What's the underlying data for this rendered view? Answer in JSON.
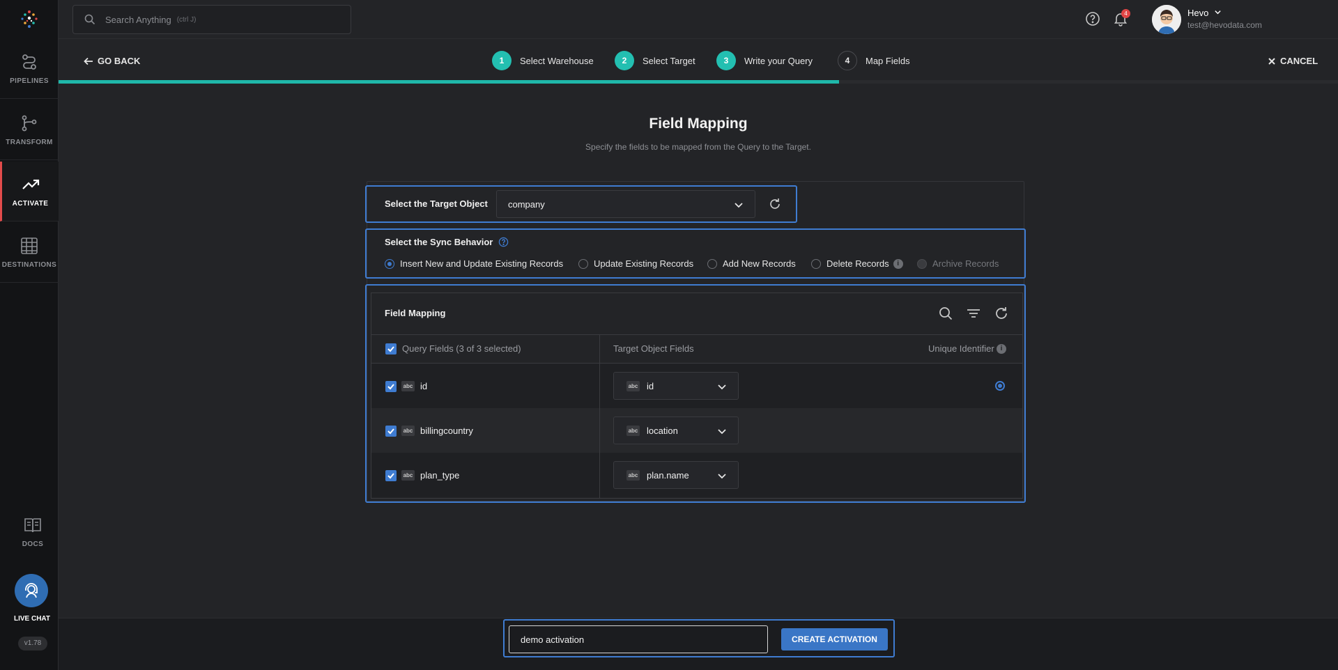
{
  "sidebar": {
    "items": [
      {
        "label": "PIPELINES",
        "icon": "pipelines-icon"
      },
      {
        "label": "TRANSFORM",
        "icon": "transform-icon"
      },
      {
        "label": "ACTIVATE",
        "icon": "activate-icon"
      },
      {
        "label": "DESTINATIONS",
        "icon": "destinations-icon"
      }
    ],
    "docs_label": "DOCS",
    "live_chat_label": "LIVE CHAT",
    "version": "v1.78",
    "active_accent": "#e24b4b"
  },
  "topbar": {
    "search_placeholder": "Search Anything",
    "search_hint": "(ctrl J)",
    "notification_count": "4",
    "user_name": "Hevo",
    "user_email": "test@hevodata.com"
  },
  "stepper": {
    "go_back": "GO BACK",
    "cancel": "CANCEL",
    "steps": [
      {
        "num": "1",
        "label": "Select Warehouse",
        "state": "done"
      },
      {
        "num": "2",
        "label": "Select Target",
        "state": "done"
      },
      {
        "num": "3",
        "label": "Write your Query",
        "state": "done"
      },
      {
        "num": "4",
        "label": "Map Fields",
        "state": "current"
      }
    ],
    "progress": 0.61,
    "accent": "#23bfb1"
  },
  "page": {
    "title": "Field Mapping",
    "subtitle": "Specify the fields to be mapped from the Query to the Target."
  },
  "target": {
    "label": "Select the Target Object",
    "value": "company"
  },
  "sync": {
    "label": "Select the Sync Behavior",
    "options": [
      {
        "label": "Insert New and Update Existing Records",
        "selected": true
      },
      {
        "label": "Update Existing Records",
        "selected": false
      },
      {
        "label": "Add New Records",
        "selected": false
      },
      {
        "label": "Delete Records",
        "selected": false
      },
      {
        "label": "Archive Records",
        "selected": false,
        "disabled": true
      }
    ]
  },
  "mapping": {
    "title": "Field Mapping",
    "columns": {
      "query": "Query Fields (3 of 3 selected)",
      "target": "Target Object Fields",
      "unique": "Unique Identifier"
    },
    "type_badge": "abc",
    "rows": [
      {
        "query_field": "id",
        "target_field": "id",
        "unique": true
      },
      {
        "query_field": "billingcountry",
        "target_field": "location",
        "unique": false
      },
      {
        "query_field": "plan_type",
        "target_field": "plan.name",
        "unique": false
      }
    ]
  },
  "footer": {
    "activation_name": "demo activation",
    "create_button": "CREATE ACTIVATION",
    "accent": "#3a76c6"
  }
}
